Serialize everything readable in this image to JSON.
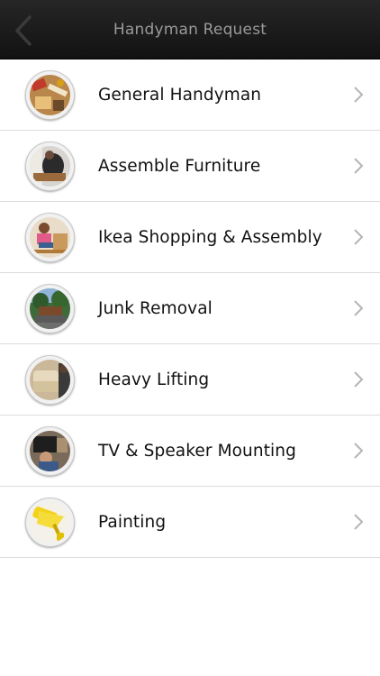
{
  "navbar": {
    "title": "Handyman Request"
  },
  "services": [
    {
      "label": "General Handyman",
      "icon": "tools-photo-icon"
    },
    {
      "label": "Assemble Furniture",
      "icon": "furniture-assembly-photo-icon"
    },
    {
      "label": "Ikea Shopping & Assembly",
      "icon": "ikea-assembly-photo-icon"
    },
    {
      "label": "Junk Removal",
      "icon": "junk-removal-photo-icon"
    },
    {
      "label": "Heavy Lifting",
      "icon": "sofa-lifting-photo-icon"
    },
    {
      "label": "TV & Speaker Mounting",
      "icon": "tv-mounting-photo-icon"
    },
    {
      "label": "Painting",
      "icon": "paint-roller-photo-icon"
    }
  ]
}
